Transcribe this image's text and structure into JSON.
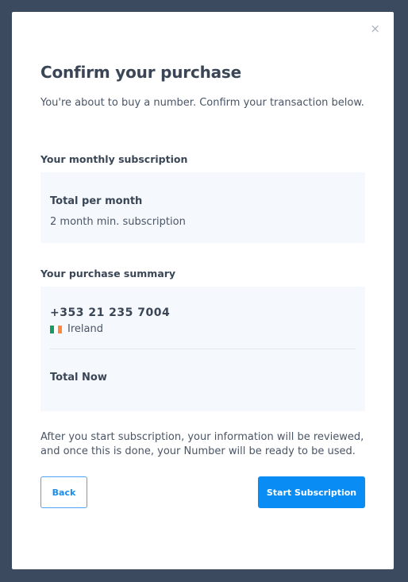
{
  "modal": {
    "close_glyph": "×",
    "title": "Confirm your purchase",
    "subtitle": "You're about to buy a number. Confirm your transaction below."
  },
  "subscription": {
    "section_label": "Your monthly subscription",
    "total_label": "Total per month",
    "min_term": "2 month min. subscription"
  },
  "summary": {
    "section_label": "Your purchase summary",
    "phone_number": "+353 21 235 7004",
    "country": "Ireland",
    "country_flag_colors": [
      "#169b62",
      "#ffffff",
      "#ff883e"
    ],
    "total_now_label": "Total Now"
  },
  "note": "After you start subscription, your information will be reviewed, and once this is done, your Number will be ready to be used.",
  "actions": {
    "back_label": "Back",
    "start_label": "Start Subscription"
  },
  "colors": {
    "backdrop": "#3b4a5f",
    "primary": "#0a8cf5",
    "panel": "#f5f8fd"
  }
}
